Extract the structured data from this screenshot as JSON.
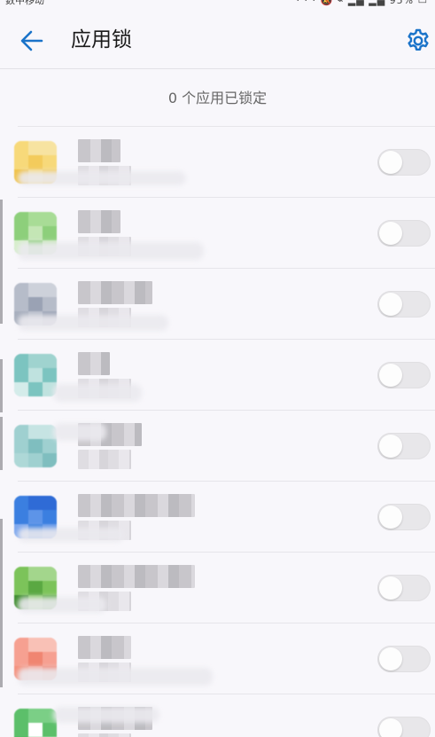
{
  "status_bar": {
    "carrier": "数中移动",
    "right_text": "· · · 🔕 ⌁ ▂▄ ▂▄ 95% ▭"
  },
  "header": {
    "title": "应用锁",
    "back_icon": "arrow-left-icon",
    "settings_icon": "gear-icon",
    "accent_color": "#1a73c9"
  },
  "summary": {
    "text": "0 个应用已锁定"
  },
  "apps": [
    {
      "name": "███",
      "status": "未锁定",
      "locked": false,
      "icon_colors": [
        "#f7d97a",
        "#f3cb5c",
        "#f7e3a1",
        "#f0c24a"
      ]
    },
    {
      "name": "███",
      "status": "未锁定",
      "locked": false,
      "icon_colors": [
        "#8dcf7b",
        "#c4e6b5",
        "#a8dc96",
        "#d6eecb"
      ]
    },
    {
      "name": "██████",
      "status": "未锁定",
      "locked": false,
      "icon_colors": [
        "#b6bcc9",
        "#9aa2b4",
        "#cdd1da",
        "#a7aebd"
      ]
    },
    {
      "name": "██",
      "status": "未锁定",
      "locked": false,
      "icon_colors": [
        "#7cc4c0",
        "#bfe2df",
        "#9fd3cf",
        "#d4ecea"
      ]
    },
    {
      "name": "████",
      "status": "未锁定",
      "locked": false,
      "icon_colors": [
        "#9fd0d0",
        "#7fbebf",
        "#c6e4e3",
        "#aed8d7"
      ]
    },
    {
      "name": "███████",
      "status": "未锁定",
      "locked": false,
      "icon_colors": [
        "#3b7fe0",
        "#5d94e8",
        "#2f6bd6",
        "#7ea8ee"
      ]
    },
    {
      "name": "███████",
      "status": "未锁定",
      "locked": false,
      "icon_colors": [
        "#7cc35a",
        "#5aa842",
        "#a3d68c",
        "#3f8d30"
      ]
    },
    {
      "name": "████",
      "status": "未锁定",
      "locked": false,
      "icon_colors": [
        "#f6a091",
        "#f08571",
        "#f9c1b6",
        "#f4927f"
      ]
    },
    {
      "name": "██████",
      "status": "未锁定",
      "locked": false,
      "icon_colors": [
        "#5cbf6a",
        "#ffffff",
        "#7bcf86",
        "#4aae58"
      ]
    }
  ]
}
